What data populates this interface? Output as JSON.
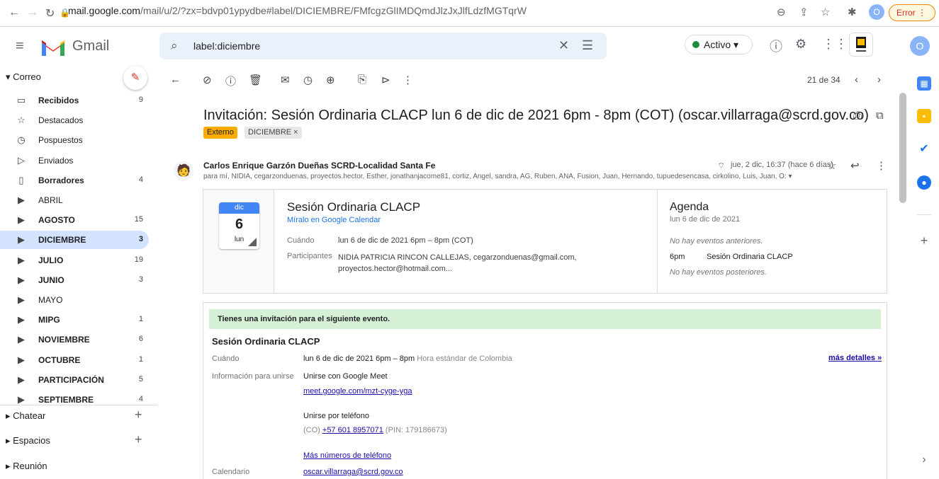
{
  "browser": {
    "url_host": "mail.google.com",
    "url_path": "/mail/u/2/?zx=bdvp01ypydbe#label/DICIEMBRE/FMfcgzGlIMDQmdJlzJxJlfLdzfMGTqrW",
    "profile_initial": "O",
    "error_label": "Error"
  },
  "header": {
    "app_name": "Gmail",
    "search_value": "label:diciembre",
    "status_label": "Activo",
    "account_initial": "O"
  },
  "sidebar": {
    "section_label": "Correo",
    "items": [
      {
        "label": "Recibidos",
        "count": "9",
        "icon": "inbox-icon",
        "bold": true
      },
      {
        "label": "Destacados",
        "count": "",
        "icon": "star-icon",
        "bold": false
      },
      {
        "label": "Pospuestos",
        "count": "",
        "icon": "clock-icon",
        "bold": false
      },
      {
        "label": "Enviados",
        "count": "",
        "icon": "send-icon",
        "bold": false
      },
      {
        "label": "Borradores",
        "count": "4",
        "icon": "draft-icon",
        "bold": true
      },
      {
        "label": "ABRIL",
        "count": "",
        "icon": "label-icon",
        "bold": false
      },
      {
        "label": "AGOSTO",
        "count": "15",
        "icon": "label-icon",
        "bold": true
      },
      {
        "label": "DICIEMBRE",
        "count": "3",
        "icon": "label-icon",
        "bold": true
      },
      {
        "label": "JULIO",
        "count": "19",
        "icon": "label-icon",
        "bold": true
      },
      {
        "label": "JUNIO",
        "count": "3",
        "icon": "label-icon",
        "bold": true
      },
      {
        "label": "MAYO",
        "count": "",
        "icon": "label-icon",
        "bold": false
      },
      {
        "label": "MIPG",
        "count": "1",
        "icon": "label-icon",
        "bold": true
      },
      {
        "label": "NOVIEMBRE",
        "count": "6",
        "icon": "label-icon",
        "bold": true
      },
      {
        "label": "OCTUBRE",
        "count": "1",
        "icon": "label-icon",
        "bold": true
      },
      {
        "label": "PARTICIPACIÓN",
        "count": "5",
        "icon": "label-icon",
        "bold": true
      },
      {
        "label": "SEPTIEMBRE",
        "count": "4",
        "icon": "label-icon",
        "bold": true
      }
    ],
    "sections": [
      "Chatear",
      "Espacios",
      "Reunión"
    ]
  },
  "toolbar": {
    "page_count": "21 de 34"
  },
  "message": {
    "subject": "Invitación: Sesión Ordinaria CLACP lun 6 de dic de 2021 6pm - 8pm (COT) (oscar.villarraga@scrd.gov.co)",
    "chip_externo": "Externo",
    "chip_label": "DICIEMBRE ×",
    "sender": "Carlos Enrique Garzón Dueñas SCRD-Localidad Santa Fe",
    "recipients": "para mí, NIDIA, cegarzonduenas, proyectos.hector, Esther, jonathanjacome81, cortiz, Angel, sandra, AG, Ruben, ANA, Fusion, Juan, Hernando, tupuedesencasa, cirkolino, Luis, Juan, O: ▾",
    "date": "jue, 2 dic, 16:37 (hace 6 días)"
  },
  "calendar_card": {
    "tile_month": "dic",
    "tile_day": "6",
    "tile_weekday": "lun",
    "event_title": "Sesión Ordinaria CLACP",
    "view_link": "Míralo en Google Calendar",
    "when_label": "Cuándo",
    "when_value": "lun 6 de dic de 2021 6pm – 8pm (COT)",
    "participants_label": "Participantes",
    "participants_value": "NIDIA PATRICIA RINCON CALLEJAS, cegarzonduenas@gmail.com, proyectos.hector@hotmail.com...",
    "agenda_title": "Agenda",
    "agenda_date": "lun 6 de dic de 2021",
    "agenda_before": "No hay eventos anteriores.",
    "agenda_time": "6pm",
    "agenda_event": "Sesión Ordinaria CLACP",
    "agenda_after": "No hay eventos posteriores."
  },
  "invitation": {
    "banner": "Tienes una invitación para el siguiente evento.",
    "event_title": "Sesión Ordinaria CLACP",
    "when_label": "Cuándo",
    "when_value": "lun 6 de dic de 2021 6pm – 8pm",
    "when_tz": "Hora estándar de Colombia",
    "more_details": "más detalles »",
    "join_label": "Información para unirse",
    "join_meet": "Unirse con Google Meet",
    "meet_link": "meet.google.com/mzt-cyge-yga",
    "join_phone": "Unirse por teléfono",
    "phone_prefix": "(CO)",
    "phone_number": "+57 601 8957071",
    "phone_pin": "(PIN: 179186673)",
    "more_phones": "Más números de teléfono",
    "calendar_label": "Calendario",
    "calendar_value": "oscar.villarraga@scrd.gov.co"
  }
}
